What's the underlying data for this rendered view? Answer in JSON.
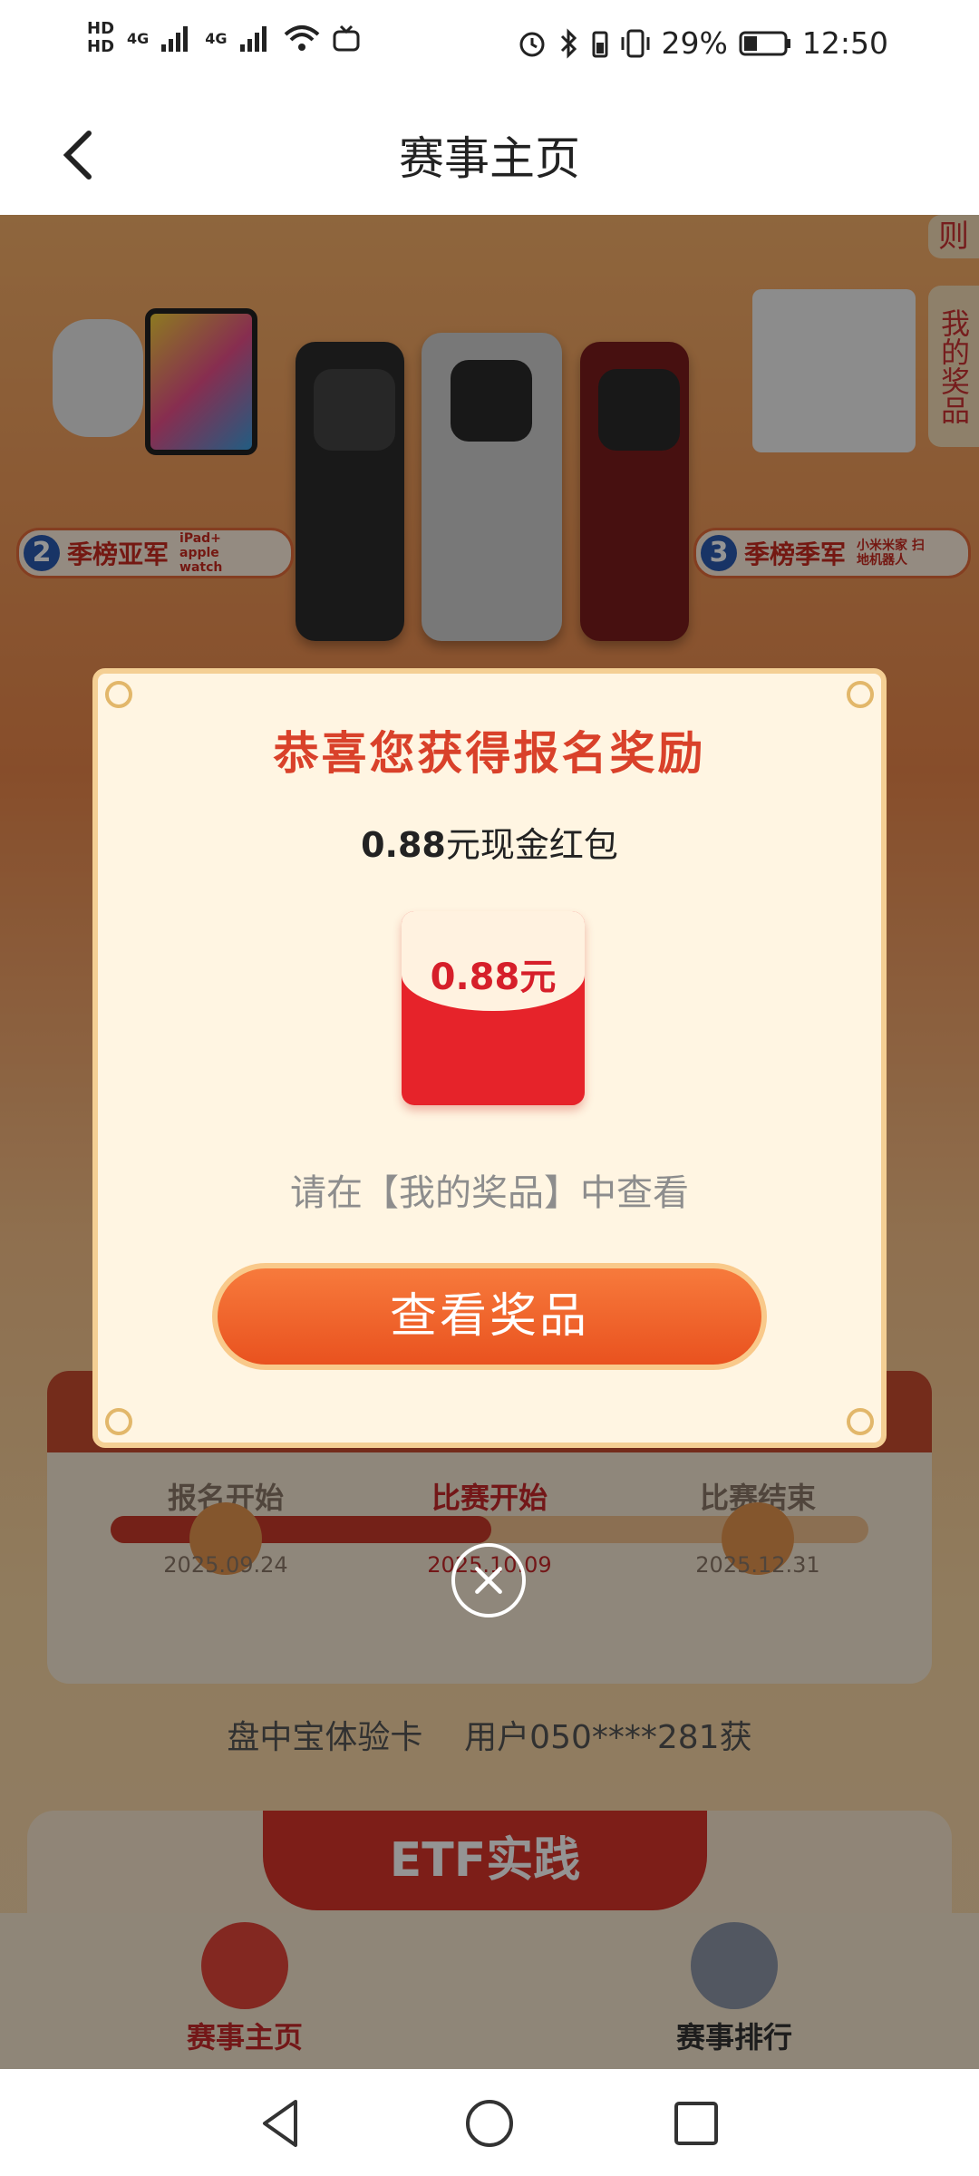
{
  "status_bar": {
    "hd1": "HD",
    "hd2": "HD",
    "net1": "4G",
    "net2": "4G",
    "battery": "29%",
    "time": "12:50"
  },
  "header": {
    "title": "赛事主页"
  },
  "side_tabs": {
    "rules": "则",
    "my_prizes": "我的奖品"
  },
  "prizes": {
    "second": {
      "rank": "2",
      "label": "季榜亚军",
      "detail": "iPad+ apple watch"
    },
    "third": {
      "rank": "3",
      "label": "季榜季军",
      "detail": "小米米家 扫地机器人"
    }
  },
  "stages": [
    {
      "label": "报名开始",
      "date": "2025.09.24"
    },
    {
      "label": "比赛开始",
      "date": "2025.10.09"
    },
    {
      "label": "比赛结束",
      "date": "2025.12.31"
    }
  ],
  "winner_ticker": "盘中宝体验卡    用户050****281获",
  "etf_banner": "ETF实践",
  "bottom_tabs": [
    {
      "label": "赛事主页",
      "active": true
    },
    {
      "label": "赛事排行",
      "active": false
    }
  ],
  "modal": {
    "title": "恭喜您获得报名奖励",
    "subtitle_amount": "0.88",
    "subtitle_text": "元现金红包",
    "envelope_amount": "0.88元",
    "hint": "请在【我的奖品】中查看",
    "button": "查看奖品"
  },
  "colors": {
    "accent_red": "#d9412a",
    "button_orange": "#f06a2e",
    "modal_bg": "#fff5e2"
  }
}
